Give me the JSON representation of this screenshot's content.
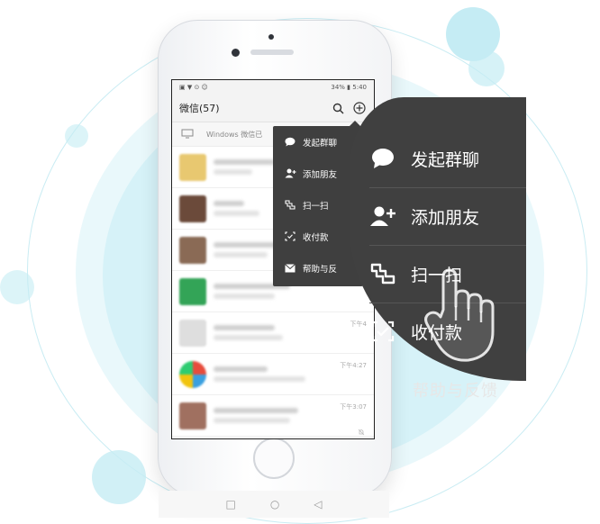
{
  "status_bar": {
    "left_icons": "▣ ▼ ⊙ ☺",
    "battery": "34%",
    "time": "5:40"
  },
  "header": {
    "title": "微信(57)",
    "search_icon": "search-icon",
    "add_icon": "plus-circle-icon"
  },
  "banner": {
    "text": "Windows 微信已"
  },
  "chats": [
    {
      "time": ""
    },
    {
      "time": ""
    },
    {
      "time": ""
    },
    {
      "time": ""
    },
    {
      "time": "下午4"
    },
    {
      "time": "下午4:27"
    },
    {
      "time": "下午3:07"
    }
  ],
  "small_menu": {
    "items": [
      {
        "label": "发起群聊",
        "icon": "chat-bubble-icon"
      },
      {
        "label": "添加朋友",
        "icon": "add-friend-icon"
      },
      {
        "label": "扫一扫",
        "icon": "scan-icon"
      },
      {
        "label": "收付款",
        "icon": "payment-icon"
      },
      {
        "label": "帮助与反",
        "icon": "mail-icon"
      }
    ]
  },
  "zoomed_menu": {
    "items": [
      {
        "label": "发起群聊",
        "icon": "chat-bubble-icon"
      },
      {
        "label": "添加朋友",
        "icon": "add-friend-icon"
      },
      {
        "label": "扫一扫",
        "icon": "scan-icon"
      },
      {
        "label": "收付款",
        "icon": "payment-icon"
      }
    ],
    "ghost_label": "帮助与反馈"
  },
  "nav_bar": {
    "square": "□",
    "circle": "○",
    "back": "◁"
  },
  "colors": {
    "menu_bg": "#3f3f3f",
    "accent_cyan": "#c5ecf4"
  }
}
